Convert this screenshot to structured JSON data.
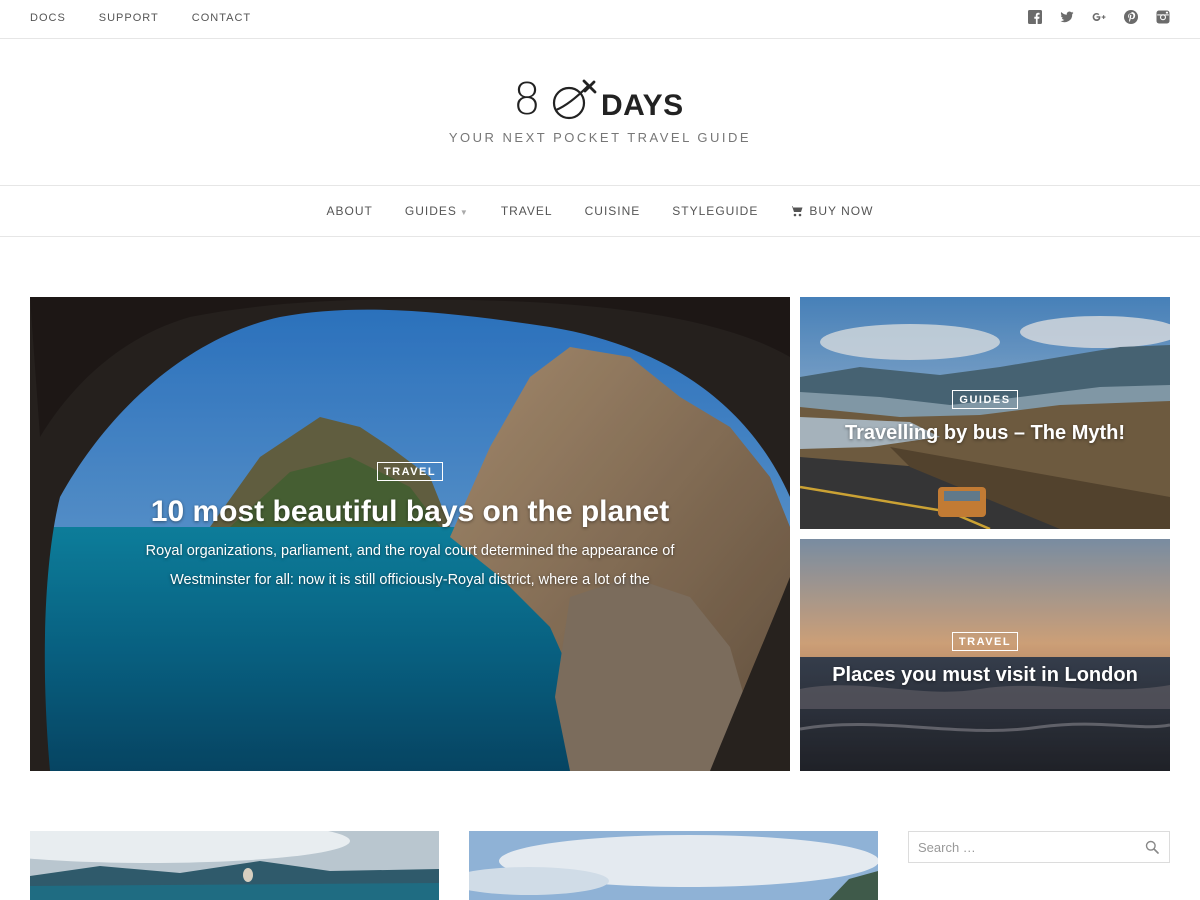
{
  "top_nav": [
    {
      "label": "DOCS"
    },
    {
      "label": "SUPPORT"
    },
    {
      "label": "CONTACT"
    }
  ],
  "social_icons": [
    "facebook-icon",
    "twitter-icon",
    "google-plus-icon",
    "pinterest-icon",
    "instagram-icon"
  ],
  "logo": {
    "numeral": "8",
    "word": "DAYS"
  },
  "tagline": "YOUR NEXT POCKET TRAVEL GUIDE",
  "main_nav": [
    {
      "label": "ABOUT",
      "has_dropdown": false
    },
    {
      "label": "GUIDES",
      "has_dropdown": true
    },
    {
      "label": "TRAVEL",
      "has_dropdown": false
    },
    {
      "label": "CUISINE",
      "has_dropdown": false
    },
    {
      "label": "STYLEGUIDE",
      "has_dropdown": false
    },
    {
      "label": "BUY NOW",
      "icon": "cart-icon"
    }
  ],
  "featured": {
    "main": {
      "category": "TRAVEL",
      "title": "10 most beautiful bays on the planet",
      "excerpt": "Royal organizations, parliament, and the royal court determined the appearance of Westminster for all: now it is still officiously-Royal district, where a lot of the"
    },
    "side": [
      {
        "category": "GUIDES",
        "title": "Travelling by bus – The Myth!"
      },
      {
        "category": "TRAVEL",
        "title": "Places you must visit in London"
      }
    ]
  },
  "search": {
    "placeholder": "Search …"
  }
}
